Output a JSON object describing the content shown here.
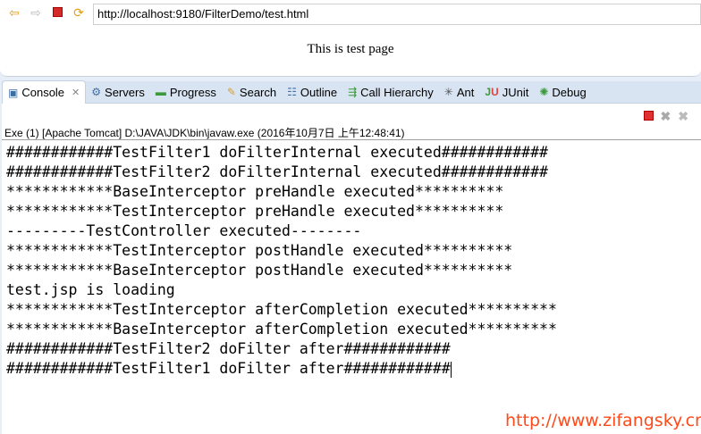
{
  "browser": {
    "url": "http://localhost:9180/FilterDemo/test.html",
    "page_text": "This is test page",
    "icons": [
      "back-arrow-icon",
      "forward-arrow-icon",
      "stop-icon",
      "refresh-icon"
    ]
  },
  "tabs": [
    {
      "label": "Console",
      "icon": "console-icon",
      "active": true
    },
    {
      "label": "Servers",
      "icon": "servers-icon"
    },
    {
      "label": "Progress",
      "icon": "progress-icon"
    },
    {
      "label": "Search",
      "icon": "search-icon"
    },
    {
      "label": "Outline",
      "icon": "outline-icon"
    },
    {
      "label": "Call Hierarchy",
      "icon": "call-hierarchy-icon"
    },
    {
      "label": "Ant",
      "icon": "ant-icon"
    },
    {
      "label": "JUnit",
      "icon": "junit-icon"
    },
    {
      "label": "Debug",
      "icon": "debug-icon"
    }
  ],
  "console": {
    "process": "Exe (1) [Apache Tomcat] D:\\JAVA\\JDK\\bin\\javaw.exe (2016年10月7日 上午12:48:41)",
    "lines": [
      "############TestFilter1 doFilterInternal executed############",
      "############TestFilter2 doFilterInternal executed############",
      "************BaseInterceptor preHandle executed**********",
      "************TestInterceptor preHandle executed**********",
      "---------TestController executed--------",
      "************TestInterceptor postHandle executed**********",
      "************BaseInterceptor postHandle executed**********",
      "test.jsp is loading",
      "************TestInterceptor afterCompletion executed**********",
      "************BaseInterceptor afterCompletion executed**********",
      "############TestFilter2 doFilter after############",
      "############TestFilter1 doFilter after############"
    ]
  },
  "watermark": "http://www.zifangsky.cn"
}
